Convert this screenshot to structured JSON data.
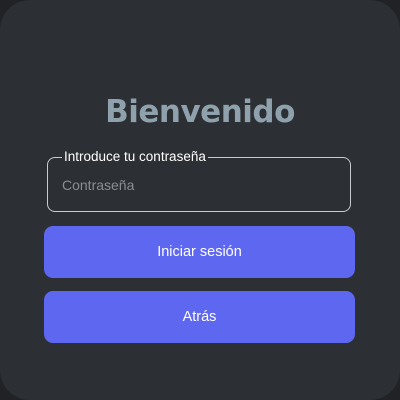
{
  "login": {
    "title": "Bienvenido",
    "password_legend": "Introduce tu contraseña",
    "password_placeholder": "Contraseña",
    "password_value": "",
    "login_button": "Iniciar sesión",
    "back_button": "Atrás"
  },
  "colors": {
    "background": "#2c2f33",
    "title": "#8fa1ad",
    "button": "#5e67f0",
    "button_text": "#ffffff",
    "field_border": "#c8cbcf"
  }
}
